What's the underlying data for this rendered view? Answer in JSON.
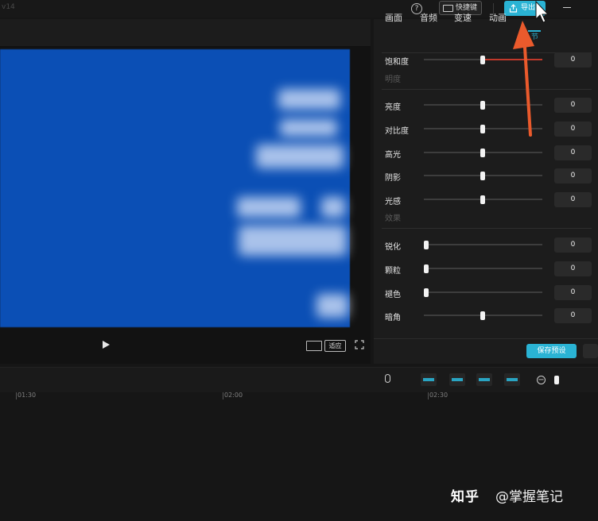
{
  "app": {
    "version": "v14"
  },
  "topbar": {
    "help_symbol": "?",
    "shortcut_label": "快捷键",
    "export_label": "导出"
  },
  "preview": {
    "fit_label": "适应"
  },
  "tabs": [
    {
      "label": "画面"
    },
    {
      "label": "音频"
    },
    {
      "label": "变速"
    },
    {
      "label": "动画"
    }
  ],
  "tab_extra": "节",
  "sections": {
    "brightness": "明度",
    "effects": "效果"
  },
  "adjustments": [
    {
      "label": "饱和度",
      "value": "0",
      "level": 0.5
    },
    {
      "label": "亮度",
      "value": "0",
      "level": 0.5
    },
    {
      "label": "对比度",
      "value": "0",
      "level": 0.5
    },
    {
      "label": "高光",
      "value": "0",
      "level": 0.5
    },
    {
      "label": "阴影",
      "value": "0",
      "level": 0.5
    },
    {
      "label": "光感",
      "value": "0",
      "level": 0.5
    },
    {
      "label": "锐化",
      "value": "0",
      "level": 0
    },
    {
      "label": "颗粒",
      "value": "0",
      "level": 0
    },
    {
      "label": "褪色",
      "value": "0",
      "level": 0
    },
    {
      "label": "暗角",
      "value": "0",
      "level": 0.5
    }
  ],
  "save_preset_label": "保存预设",
  "timeline": {
    "ticks": [
      "01:30",
      "02:00",
      "02:30"
    ]
  },
  "zoom_out_symbol": "−",
  "watermark": {
    "site": "知乎",
    "author": "@掌握笔记"
  },
  "colors": {
    "accent": "#2ab3d4",
    "arrow": "#ea5a2c",
    "video_bg": "#0b4fb5"
  },
  "icons": [
    "help-icon",
    "keyboard-icon",
    "export-icon",
    "cursor-icon",
    "play-icon",
    "waveform-icon",
    "fullscreen-icon",
    "microphone-icon",
    "zoom-out-icon"
  ]
}
